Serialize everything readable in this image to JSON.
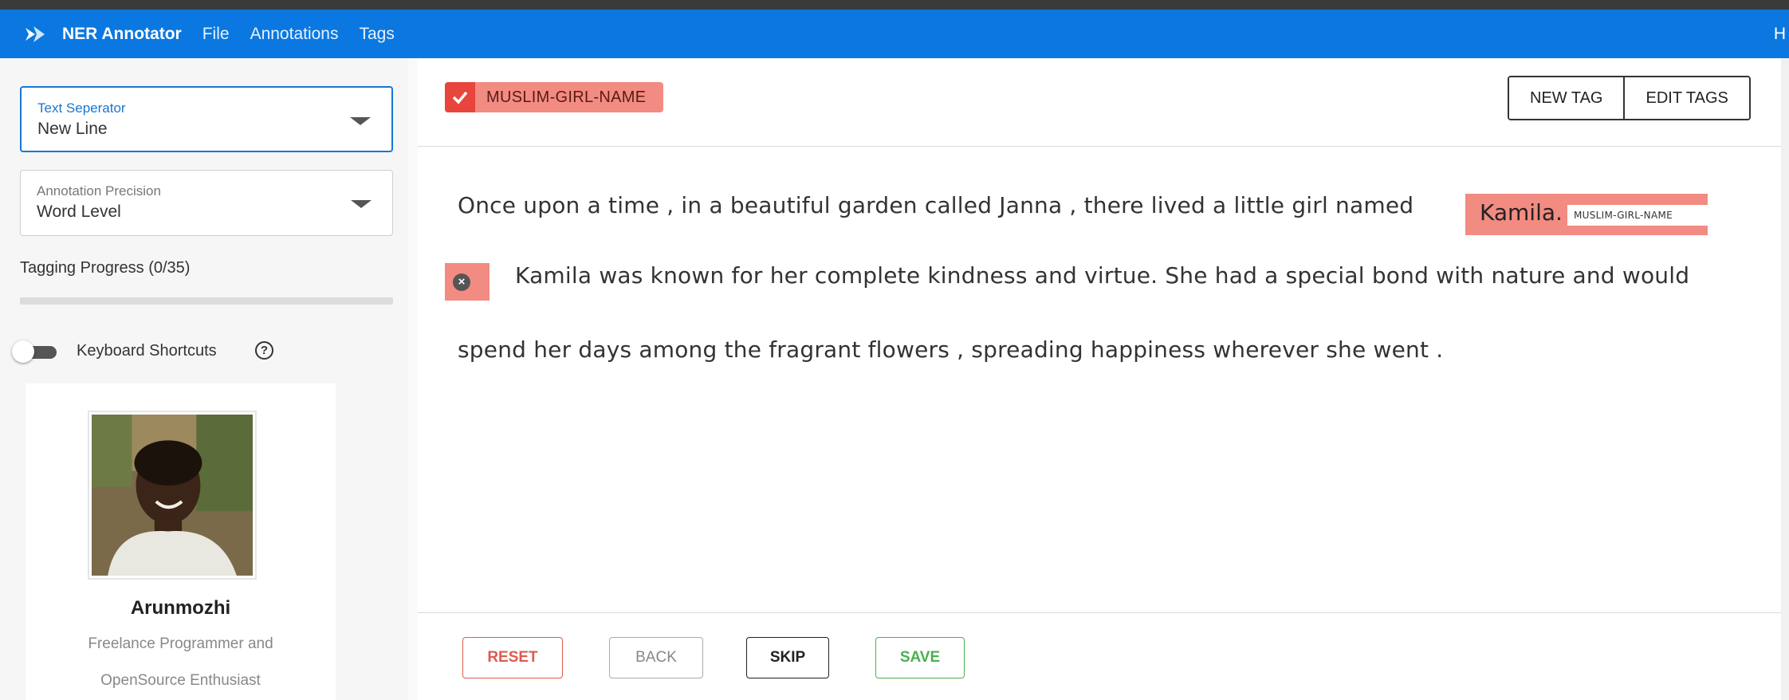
{
  "navbar": {
    "brand": "NER Annotator",
    "menu": [
      "File",
      "Annotations",
      "Tags"
    ],
    "right_text": "H",
    "logo_icon": "annotator-logo-icon"
  },
  "sidebar": {
    "text_separator": {
      "label": "Text Seperator",
      "value": "New Line"
    },
    "annotation_precision": {
      "label": "Annotation Precision",
      "value": "Word Level"
    },
    "progress": {
      "label": "Tagging Progress (0/35)",
      "done": 0,
      "total": 35
    },
    "keyboard_shortcuts": {
      "label": "Keyboard Shortcuts",
      "enabled": false
    },
    "profile": {
      "name": "Arunmozhi",
      "bio_line1": "Freelance Programmer and",
      "bio_line2": "OpenSource Enthusiast"
    }
  },
  "tagbar": {
    "active_tag": "MUSLIM-GIRL-NAME",
    "new_tag_label": "NEW TAG",
    "edit_tags_label": "EDIT TAGS"
  },
  "document": {
    "line1": "Once upon a time , in a beautiful garden called Janna , there lived a little girl named",
    "entity_text": "Kamila.",
    "entity_label": "MUSLIM-GIRL-NAME",
    "line2": "Kamila was known for her complete kindness and virtue. She had a special bond with nature and would",
    "line3": "spend her days among the fragrant flowers , spreading happiness wherever she went ."
  },
  "footer": {
    "reset": "RESET",
    "back": "BACK",
    "skip": "SKIP",
    "save": "SAVE"
  },
  "colors": {
    "navbar": "#0a78e0",
    "tag": "#f28b82",
    "tag_check": "#e8453c",
    "reset": "#e05a4f",
    "save": "#4caf50"
  }
}
